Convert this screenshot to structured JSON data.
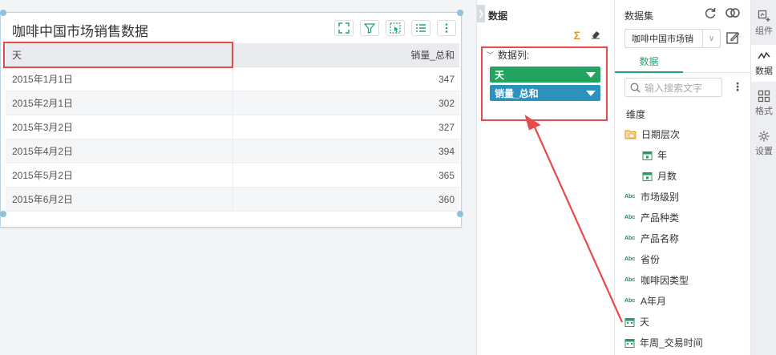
{
  "widget": {
    "title": "咖啡中国市场销售数据",
    "columns": [
      "天",
      "销量_总和"
    ],
    "rows": [
      {
        "date": "2015年1月1日",
        "value": "347"
      },
      {
        "date": "2015年2月1日",
        "value": "302"
      },
      {
        "date": "2015年3月2日",
        "value": "327"
      },
      {
        "date": "2015年4月2日",
        "value": "394"
      },
      {
        "date": "2015年5月2日",
        "value": "365"
      },
      {
        "date": "2015年6月2日",
        "value": "360"
      }
    ]
  },
  "data_panel": {
    "title": "数据",
    "columns_label": "数据列:",
    "chips": [
      {
        "label": "天",
        "color": "#22a35f"
      },
      {
        "label": "销量_总和",
        "color": "#2b92bd"
      }
    ]
  },
  "dataset_panel": {
    "title": "数据集",
    "selected": "咖啡中国市场销",
    "tab": "数据",
    "search_placeholder": "输入搜索文字",
    "dimension_label": "维度",
    "fields": [
      {
        "label": "日期层次",
        "icon": "folder-calendar-icon",
        "level": 0
      },
      {
        "label": "年",
        "icon": "calendar-icon",
        "level": 1
      },
      {
        "label": "月数",
        "icon": "calendar-icon",
        "level": 1
      },
      {
        "label": "市场级别",
        "icon": "abc-icon",
        "level": 0
      },
      {
        "label": "产品种类",
        "icon": "abc-icon",
        "level": 0
      },
      {
        "label": "产品名称",
        "icon": "abc-icon",
        "level": 0
      },
      {
        "label": "省份",
        "icon": "abc-icon",
        "level": 0
      },
      {
        "label": "咖啡因类型",
        "icon": "abc-icon",
        "level": 0
      },
      {
        "label": "A年月",
        "icon": "abc-icon",
        "level": 0
      },
      {
        "label": "天",
        "icon": "calendar-icon",
        "level": 0
      },
      {
        "label": "年周_交易时间",
        "icon": "calendar-icon",
        "level": 0
      }
    ]
  },
  "rail": {
    "items": [
      {
        "label": "组件",
        "icon": "component-icon"
      },
      {
        "label": "数据",
        "icon": "data-icon"
      },
      {
        "label": "格式",
        "icon": "format-icon"
      },
      {
        "label": "设置",
        "icon": "settings-icon"
      }
    ]
  },
  "colors": {
    "accent": "#24a46d",
    "annotation": "#e64a4a"
  }
}
